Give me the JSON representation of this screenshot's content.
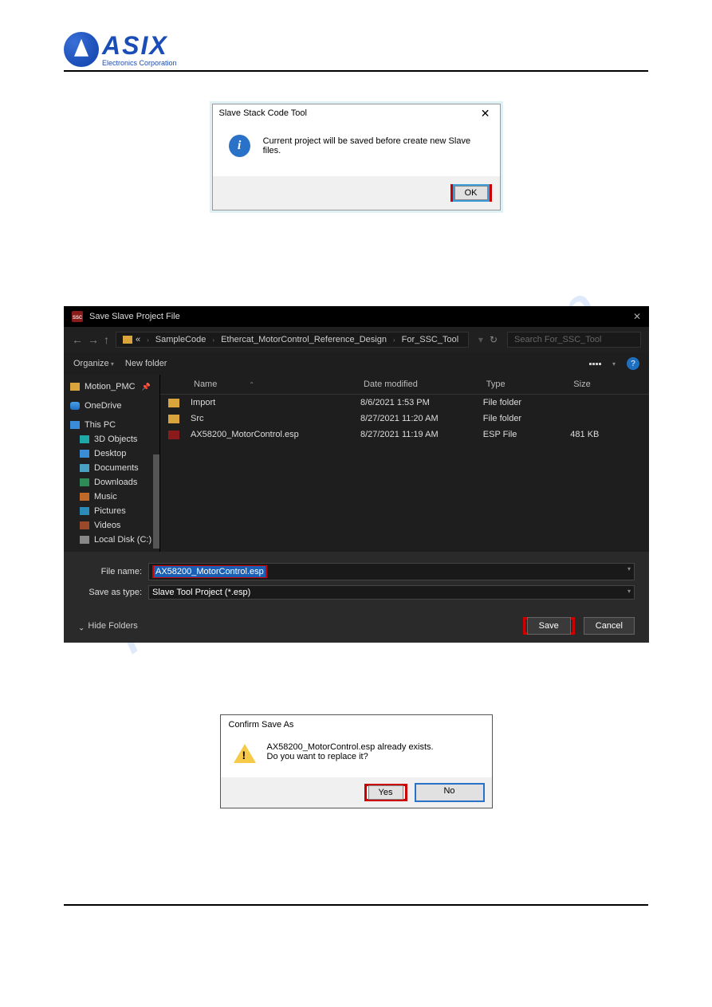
{
  "logo": {
    "brand": "ASIX",
    "sub": "Electronics Corporation"
  },
  "watermark": "manualshive.com",
  "dialog_info": {
    "title": "Slave Stack Code Tool",
    "close": "✕",
    "icon_letter": "i",
    "message": "Current project will be saved before create new Slave files.",
    "ok": "OK"
  },
  "save_dialog": {
    "app_icon_text": "ssc",
    "window_title": "Save Slave Project File",
    "close": "✕",
    "nav_back": "←",
    "nav_fwd": "→",
    "nav_up": "↑",
    "crumbs": [
      "«",
      "SampleCode",
      "Ethercat_MotorControl_Reference_Design",
      "For_SSC_Tool"
    ],
    "refresh": "↻",
    "search_placeholder": "Search For_SSC_Tool",
    "organize": "Organize",
    "new_folder": "New folder",
    "help": "?",
    "sidebar": [
      {
        "icon": "folder",
        "label": "Motion_PMC",
        "pin": true
      },
      {
        "icon": "cloud",
        "label": "OneDrive"
      },
      {
        "icon": "pc",
        "label": "This PC"
      },
      {
        "icon": "obj3d",
        "label": "3D Objects",
        "sub": true
      },
      {
        "icon": "desk",
        "label": "Desktop",
        "sub": true
      },
      {
        "icon": "doc",
        "label": "Documents",
        "sub": true
      },
      {
        "icon": "dl",
        "label": "Downloads",
        "sub": true
      },
      {
        "icon": "music",
        "label": "Music",
        "sub": true
      },
      {
        "icon": "pic",
        "label": "Pictures",
        "sub": true
      },
      {
        "icon": "vid",
        "label": "Videos",
        "sub": true
      },
      {
        "icon": "disk",
        "label": "Local Disk (C:)",
        "sub": true
      }
    ],
    "columns": {
      "name": "Name",
      "date": "Date modified",
      "type": "Type",
      "size": "Size"
    },
    "rows": [
      {
        "icon": "folder",
        "name": "Import",
        "date": "8/6/2021 1:53 PM",
        "type": "File folder",
        "size": ""
      },
      {
        "icon": "folder",
        "name": "Src",
        "date": "8/27/2021 11:20 AM",
        "type": "File folder",
        "size": ""
      },
      {
        "icon": "esp",
        "name": "AX58200_MotorControl.esp",
        "date": "8/27/2021 11:19 AM",
        "type": "ESP File",
        "size": "481 KB"
      }
    ],
    "file_name_label": "File name:",
    "file_name_value": "AX58200_MotorControl.esp",
    "save_type_label": "Save as type:",
    "save_type_value": "Slave Tool Project  (*.esp)",
    "hide_folders": "Hide Folders",
    "save": "Save",
    "cancel": "Cancel"
  },
  "confirm": {
    "title": "Confirm Save As",
    "line1": "AX58200_MotorControl.esp already exists.",
    "line2": "Do you want to replace it?",
    "yes": "Yes",
    "no": "No"
  }
}
